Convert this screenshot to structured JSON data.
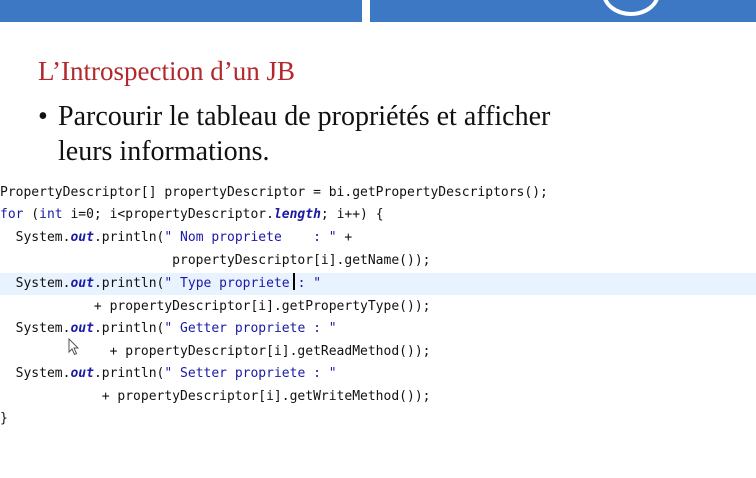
{
  "slide": {
    "title": "L’Introspection d’un JB",
    "bullet_symbol": "•",
    "bullet_line1": "Parcourir le tableau de propriétés et afficher",
    "bullet_line2": "leurs informations."
  },
  "code": {
    "l1": "PropertyDescriptor[] propertyDescriptor = bi.getPropertyDescriptors();",
    "l2_kw1": "for",
    "l2_p1": " (",
    "l2_kw2": "int",
    "l2_p2": " i=0; i<propertyDescriptor.",
    "l2_fld": "length",
    "l2_p3": "; i++) {",
    "l3_p1": "  System.",
    "l3_fld": "out",
    "l3_p2": ".println(",
    "l3_str": "\" Nom propriete    : \"",
    "l3_p3": " +",
    "l4": "                      propertyDescriptor[i].getName());",
    "l5_p1": "  System.",
    "l5_fld": "out",
    "l5_p2": ".println(",
    "l5_str1": "\" Type propriete",
    "l5_str2": ": \"",
    "l6": "            + propertyDescriptor[i].getPropertyType());",
    "l7_p1": "  System.",
    "l7_fld": "out",
    "l7_p2": ".println(",
    "l7_str": "\" Getter propriete : \"",
    "l8": "              + propertyDescriptor[i].getReadMethod());",
    "l9_p1": "  System.",
    "l9_fld": "out",
    "l9_p2": ".println(",
    "l9_str": "\" Setter propriete : \"",
    "l10": "             + propertyDescriptor[i].getWriteMethod());",
    "l11": "}"
  },
  "colors": {
    "header_bar": "#3d78c4",
    "title": "#b3282d",
    "keyword": "#1a1aa6",
    "highlight_line": "#e9f2ff"
  },
  "icons": {
    "cursor": "mouse-pointer-icon",
    "logo": "logo-circle-icon"
  }
}
